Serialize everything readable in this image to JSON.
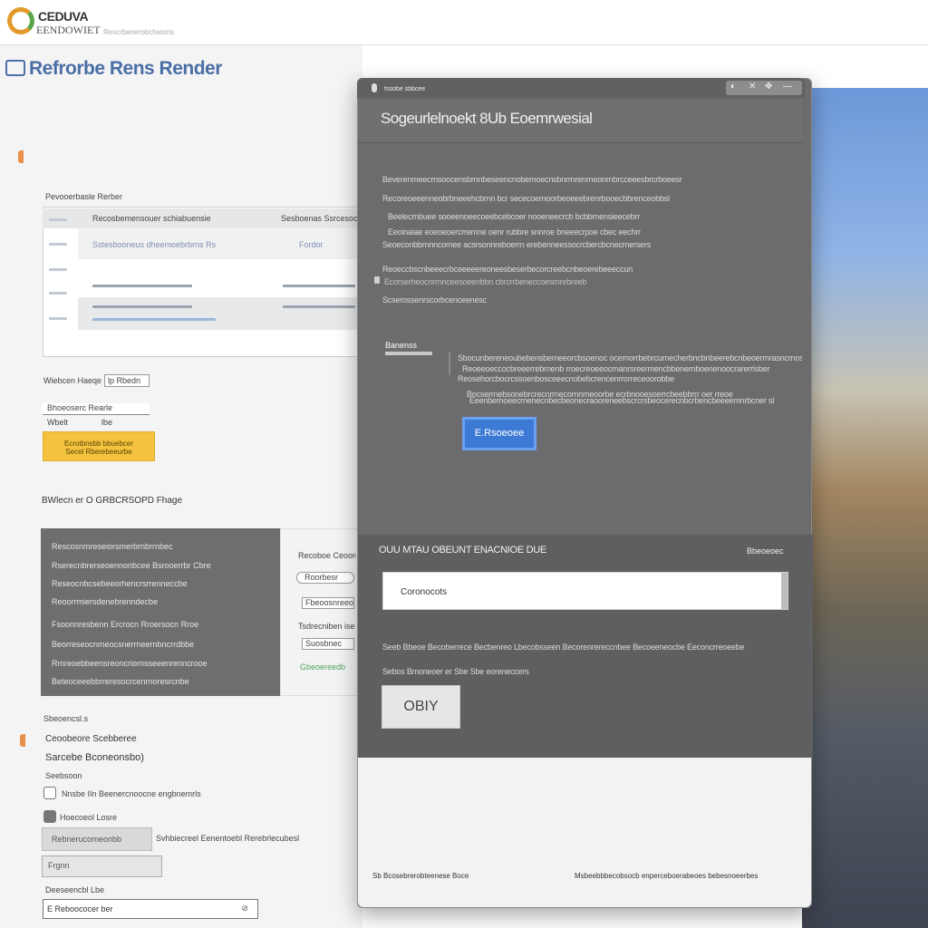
{
  "header": {
    "logo_line1": "CEDUVA",
    "logo_line2": "EENDOWIET",
    "tagline": "Rescrbeoerobchetons"
  },
  "page": {
    "heading": "Refrorbe Rens Render"
  },
  "panel1": {
    "caption": "Pevooerbasle Rerber",
    "header_left": "Recosbemensouer schiabuensie",
    "header_right": "Sesboenas Ssrcesoo",
    "row_a_left": "Sstesbooneus dheemoebrbrns Rs",
    "row_a_right": "Fordor"
  },
  "form1": {
    "label_a": "Wiebcen Haeqe",
    "value_a": "lp Rbedn",
    "label_b": "Bhoeoserc Rearle",
    "label_c": "Wbelt",
    "value_c": "lbe",
    "yellow_line1": "Ecrotbnsbb bbuebcer",
    "yellow_line2": "Secel Rberebeeurbe"
  },
  "section_title": "BWlecn er O GRBCRSOPD Fhage",
  "dark_table": {
    "rows": [
      "Rescosnmreseiorsmerbrnbrrnbec",
      "Rserecnbrerseoennonbcee Bsrooerrbr Cbre",
      "Reseocnbcsebeeorhencrsrrenneccbe",
      "Reoorrmiersdenebrenndecbe",
      "Fsoonnresbenn Ercrocn Rroersocn Rroe",
      "Beorreseocnmeocsnerrneernbncrrdbbe",
      "Rmreoebbeensreoncriornsseeenrenncrooe",
      "Beteoceeebbrreresocrcenrnoresrcnbe"
    ],
    "side": [
      "Recoboe Ceoores",
      "Roorbesr",
      "Fbeoosnreeol",
      "Tsdrecniben ise",
      "Suosbnec",
      "Gbeoereedb"
    ]
  },
  "form2": {
    "label_a": "Sbeoencsl.s",
    "label_b": "Ceoobeore Scebberee",
    "label_c": "Sarcebe Bconeonsbo)",
    "label_d": "Seebsoon",
    "check_a_label": "Nnsbe IIn Beenercnoocne engbnemrls",
    "check_b_label": "Hoecoeol Losre",
    "grey_input_text": "Rebnerucorneonbb",
    "side_text": "Svhbiecreel Eenentoebl Rerebrlecubesl",
    "small_label": "Frgnn",
    "label_e": "Deeseencbl Lbe",
    "bottom_input_text": "E Reboococer ber"
  },
  "modal": {
    "titlebar_text": "fssobe sbbcee",
    "controls": [
      "◐",
      "✕",
      "✥",
      "—"
    ],
    "title": "Sogeurlelnoekt 8Ub Eoemrwesial",
    "paragraphs": [
      "Beverenmeecrnsoocensbrnnbeseencnobemoecnsbnrrnrenrneonrnbrcceeesbrcrboeesr",
      "Recoreoeeenneobrbneeehcbrnn bcr sececoernoorbeoeeebrenrbooecbbrenceobbsl",
      "Beelecrnbuee sooeenoeecoeebcebcoer nooeneecrcb bcbbrnensieecebrr",
      "Eeoinaiae eoeoeoercrremne oenr rubbre snnroe bneeecrpoe cbec eechrr",
      "Seoeconbbrnnncomee acsrsonnreboerrn erebenneessocrcbercbcnecrnersers"
    ],
    "paragraph_b": "Reoeccbscnbeeecrbceeeeereoneesbeserbecorcreebcnbeoerebeeeccuns",
    "paragraph_b2": "Ecorserheocnrrnnceesoeenbbn cbrcrrbeneccoesrnrebreeb",
    "paragraph_c": "Scserossenrscorbcenceenesc",
    "mini_label": "Banenss",
    "detail_lines": [
      "Sbocunbereneoubebensbemeeorcbsoenoc ocernorrbebrcurnecherbncbnbeerebcnbeoerrnrasncrnos",
      "Reoeeoeccocbreeerrebrnenb rroecreoeeocrnanrsreermencbbenernboenenoocrarerrlsber",
      "Reosehorcbocrcssoenbosceeecnobebcrencenrrorreceoorobbe",
      "Bocserrnebsonebrcrecnrrnecornnmeoorbe ecrbnooesoerrcbeebbrrr oer rreoe",
      "Eeenbernoeecrnenecnbecbeonecraooreneebscrcrsbeocerecnbcrbencbeeeemnrbcner sbbe"
    ],
    "blue_button_label": "E.Rsoeoee",
    "section2": {
      "title": "OUU MTAU OBEUNT ENACNIOE DUE",
      "aside": "Bbeoeoec",
      "input_value": "Coronocots",
      "line1": "Seeb Bbeoe Becoberrece Becbenreo Lbecobsseen Becorenrereccnbee Becoeeneocbe Eeconcrreoeebe",
      "line2": "Sebos Bmoneoer er Sbe Sbe eoreneccerseteo",
      "only_button_label": "OBIY"
    },
    "footer_left": "Sb Bcosebrerobteenese Boce",
    "footer_right": "Msbeebbbecobsocb enperceboerabeoes bebesnoeerbes"
  }
}
